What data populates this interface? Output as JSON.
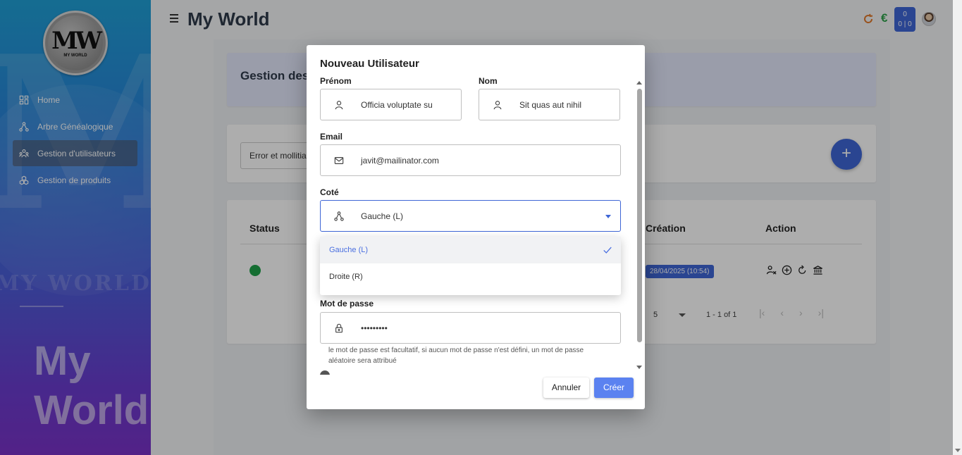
{
  "app": {
    "title": "My World"
  },
  "logo": {
    "initials": "MW",
    "subtitle": "MY WORLD"
  },
  "sidebar": {
    "watermark_text": "MY WORLD",
    "bigword_1": "My",
    "bigword_2": "World",
    "items": [
      {
        "label": "Home",
        "icon": "dashboard-icon"
      },
      {
        "label": "Arbre Généalogique",
        "icon": "tree-icon"
      },
      {
        "label": "Gestion d'utilisateurs",
        "icon": "users-icon",
        "active": true
      },
      {
        "label": "Gestion de produits",
        "icon": "products-icon"
      }
    ]
  },
  "header": {
    "counter_top": "0",
    "counter_bottom": "0 | 0",
    "euro": "€"
  },
  "page": {
    "banner_title": "Gestion des",
    "filter_value": "Error et mollitia",
    "add_label": "+",
    "table": {
      "col_status": "Status",
      "col_creation": "Création",
      "col_action": "Action",
      "row_date": "28/04/2025 (10:54)",
      "status_color": "#1fa24a"
    },
    "pager": {
      "page_size": "5",
      "range": "1 - 1 of 1"
    }
  },
  "dialog": {
    "title": "Nouveau Utilisateur",
    "prenom_label": "Prénom",
    "prenom_value": "Officia voluptate su",
    "nom_label": "Nom",
    "nom_value": "Sit quas aut nihil",
    "email_label": "Email",
    "email_value": "javit@mailinator.com",
    "cote_label": "Coté",
    "cote_value": "Gauche (L)",
    "password_label": "Mot de passe",
    "password_value": "•••••••••",
    "password_hint": "le mot de passe est facultatif, si aucun mot de passe n'est défini, un mot de passe aléatoire sera attribué",
    "cancel_label": "Annuler",
    "create_label": "Créer"
  },
  "dropdown": {
    "options": [
      {
        "label": "Gauche (L)",
        "selected": true
      },
      {
        "label": "Droite (R)",
        "selected": false
      }
    ]
  },
  "colors": {
    "accent": "#3e66d6",
    "create_button": "#5b82f0",
    "euro": "#2fa34a",
    "refresh": "#e0782a"
  }
}
